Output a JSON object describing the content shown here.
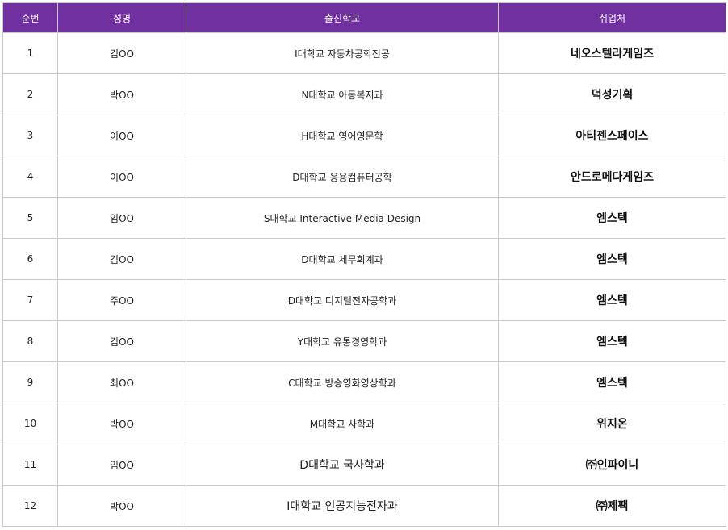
{
  "table": {
    "headers": [
      "순번",
      "성명",
      "출신학교",
      "취업처"
    ],
    "rows": [
      {
        "no": "1",
        "name": "김OO",
        "school": "I대학교 자동차공학전공",
        "company": "네오스텔라게임즈"
      },
      {
        "no": "2",
        "name": "박OO",
        "school": "N대학교 아동복지과",
        "company": "덕성기획"
      },
      {
        "no": "3",
        "name": "이OO",
        "school": "H대학교 영어영문학",
        "company": "아티젠스페이스"
      },
      {
        "no": "4",
        "name": "이OO",
        "school": "D대학교 응용컴퓨터공학",
        "company": "안드로메다게임즈"
      },
      {
        "no": "5",
        "name": "임OO",
        "school": "S대학교 Interactive Media Design",
        "company": "엠스텍"
      },
      {
        "no": "6",
        "name": "김OO",
        "school": "D대학교 세무회계과",
        "company": "엠스텍"
      },
      {
        "no": "7",
        "name": "주OO",
        "school": "D대학교 디지털전자공학과",
        "company": "엠스텍"
      },
      {
        "no": "8",
        "name": "김OO",
        "school": "Y대학교 유통경영학과",
        "company": "엠스텍"
      },
      {
        "no": "9",
        "name": "최OO",
        "school": "C대학교 방송영화영상학과",
        "company": "엠스텍"
      },
      {
        "no": "10",
        "name": "박OO",
        "school": "M대학교 사학과",
        "company": "위지온"
      },
      {
        "no": "11",
        "name": "임OO",
        "school": "D대학교 국사학과",
        "company": "㈜인파이니"
      },
      {
        "no": "12",
        "name": "박OO",
        "school": "I대학교 인공지능전자과",
        "company": "㈜제팩"
      }
    ]
  },
  "colors": {
    "header_bg": "#7030a0",
    "header_text": "#ffffff",
    "border": "#c9c9c9"
  }
}
